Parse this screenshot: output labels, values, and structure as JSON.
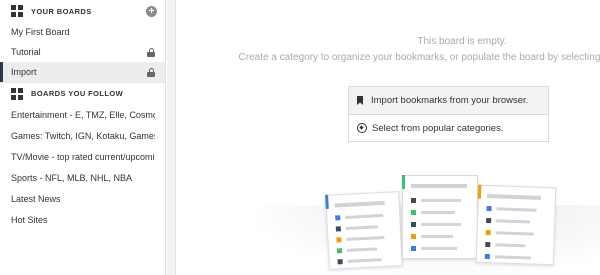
{
  "sidebar": {
    "your_boards": {
      "title": "YOUR BOARDS",
      "add_icon": "plus-circle-icon",
      "items": [
        {
          "label": "My First Board",
          "locked": false,
          "active": false
        },
        {
          "label": "Tutorial",
          "locked": true,
          "active": false
        },
        {
          "label": "Import",
          "locked": true,
          "active": true
        }
      ]
    },
    "boards_you_follow": {
      "title": "BOARDS YOU FOLLOW",
      "items": [
        {
          "label": "Entertainment - E, TMZ, Elle, Cosmo"
        },
        {
          "label": "Games: Twitch, IGN, Kotaku, Games Radar"
        },
        {
          "label": "TV/Movie - top rated current/upcoming"
        },
        {
          "label": "Sports - NFL, MLB, NHL, NBA"
        },
        {
          "label": "Latest News"
        },
        {
          "label": "Hot Sites"
        }
      ]
    }
  },
  "main": {
    "empty_title": "This board is empty.",
    "empty_desc": "Create a category to organize your bookmarks, or populate the board by selecting an option below.",
    "options": [
      {
        "label": "Import bookmarks from your browser.",
        "icon": "bookmark-icon"
      },
      {
        "label": "Select from popular categories.",
        "icon": "compass-icon"
      }
    ]
  },
  "colors": {
    "active_indicator": "#2d3a45",
    "card_blue": "#3b7ddd",
    "card_green": "#3fbf74",
    "card_orange": "#f39c12",
    "card_dark": "#3d4a5a",
    "card_teal": "#2bb6a3"
  }
}
